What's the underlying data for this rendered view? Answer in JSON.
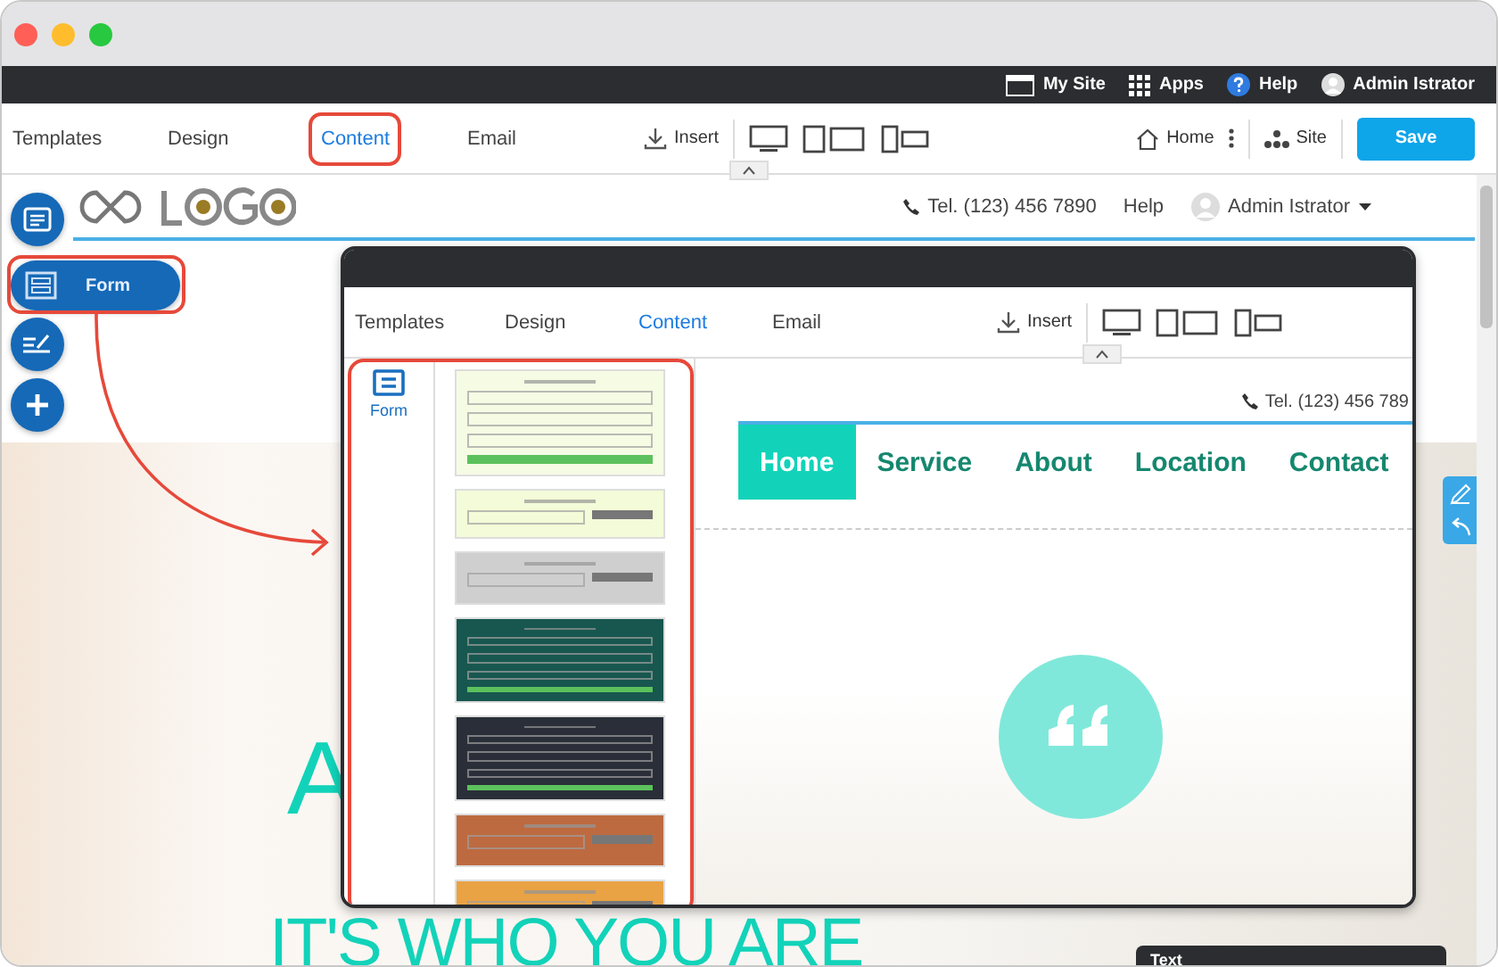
{
  "top_bar": {
    "items": [
      {
        "kind": "site",
        "label": "My Site"
      },
      {
        "kind": "apps",
        "label": "Apps"
      },
      {
        "kind": "help",
        "label": "Help"
      },
      {
        "kind": "user",
        "label": "Admin Istrator"
      }
    ]
  },
  "toolbar": {
    "tabs": [
      {
        "label": "Templates",
        "selected": false,
        "highlighted": false
      },
      {
        "label": "Design",
        "selected": false,
        "highlighted": false
      },
      {
        "label": "Content",
        "selected": true,
        "highlighted": true
      },
      {
        "label": "Email",
        "selected": false,
        "highlighted": false
      }
    ],
    "insert": "Insert",
    "home": "Home",
    "site": "Site",
    "save": "Save"
  },
  "site_header": {
    "phone": "Tel. (123) 456 7890",
    "help": "Help",
    "user": "Admin Istrator"
  },
  "side_buttons": [
    {
      "kind": "layout"
    },
    {
      "kind": "form",
      "label": "Form"
    },
    {
      "kind": "edit"
    },
    {
      "kind": "add"
    }
  ],
  "hero": {
    "lines": [
      "A",
      "IT'S WHO YOU ARE"
    ]
  },
  "popup": {
    "tabs": [
      {
        "label": "Templates",
        "selected": false
      },
      {
        "label": "Design",
        "selected": false
      },
      {
        "label": "Content",
        "selected": true
      },
      {
        "label": "Email",
        "selected": false
      }
    ],
    "insert": "Insert",
    "panel_label": "Form",
    "thumbnails": [
      {
        "kind": "contact",
        "color": "#f6fbe4"
      },
      {
        "kind": "subscribe",
        "color": "#f4fbd8"
      },
      {
        "kind": "subscribe",
        "color": "#cfcfcf"
      },
      {
        "kind": "contact",
        "color": "#17574f"
      },
      {
        "kind": "contact",
        "color": "#2a2e38"
      },
      {
        "kind": "subscribe",
        "color": "#bd6a40"
      },
      {
        "kind": "subscribe",
        "color": "#e9a244"
      }
    ],
    "phone": "Tel. (123) 456 789",
    "nav": [
      {
        "label": "Home",
        "selected": true
      },
      {
        "label": "Service",
        "selected": false
      },
      {
        "label": "About",
        "selected": false
      },
      {
        "label": "Location",
        "selected": false
      },
      {
        "label": "Contact",
        "selected": false
      }
    ]
  },
  "text_panel": {
    "title": "Text"
  }
}
